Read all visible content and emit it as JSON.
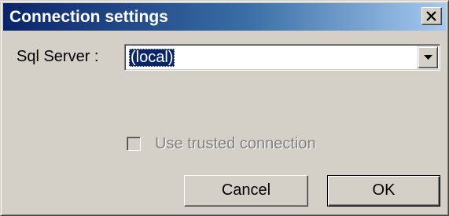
{
  "window": {
    "title": "Connection settings",
    "close_label": "×"
  },
  "server": {
    "label": "Sql Server :",
    "selected_value": "(local)"
  },
  "trusted_connection": {
    "label": "Use trusted connection",
    "checked": false,
    "enabled": false
  },
  "buttons": {
    "cancel_label": "Cancel",
    "ok_label": "OK"
  },
  "colors": {
    "titlebar_start": "#0a246a",
    "titlebar_end": "#a6caf0",
    "dialog_face": "#d4d0c8",
    "selection": "#0a246a",
    "disabled_text": "#808080"
  }
}
